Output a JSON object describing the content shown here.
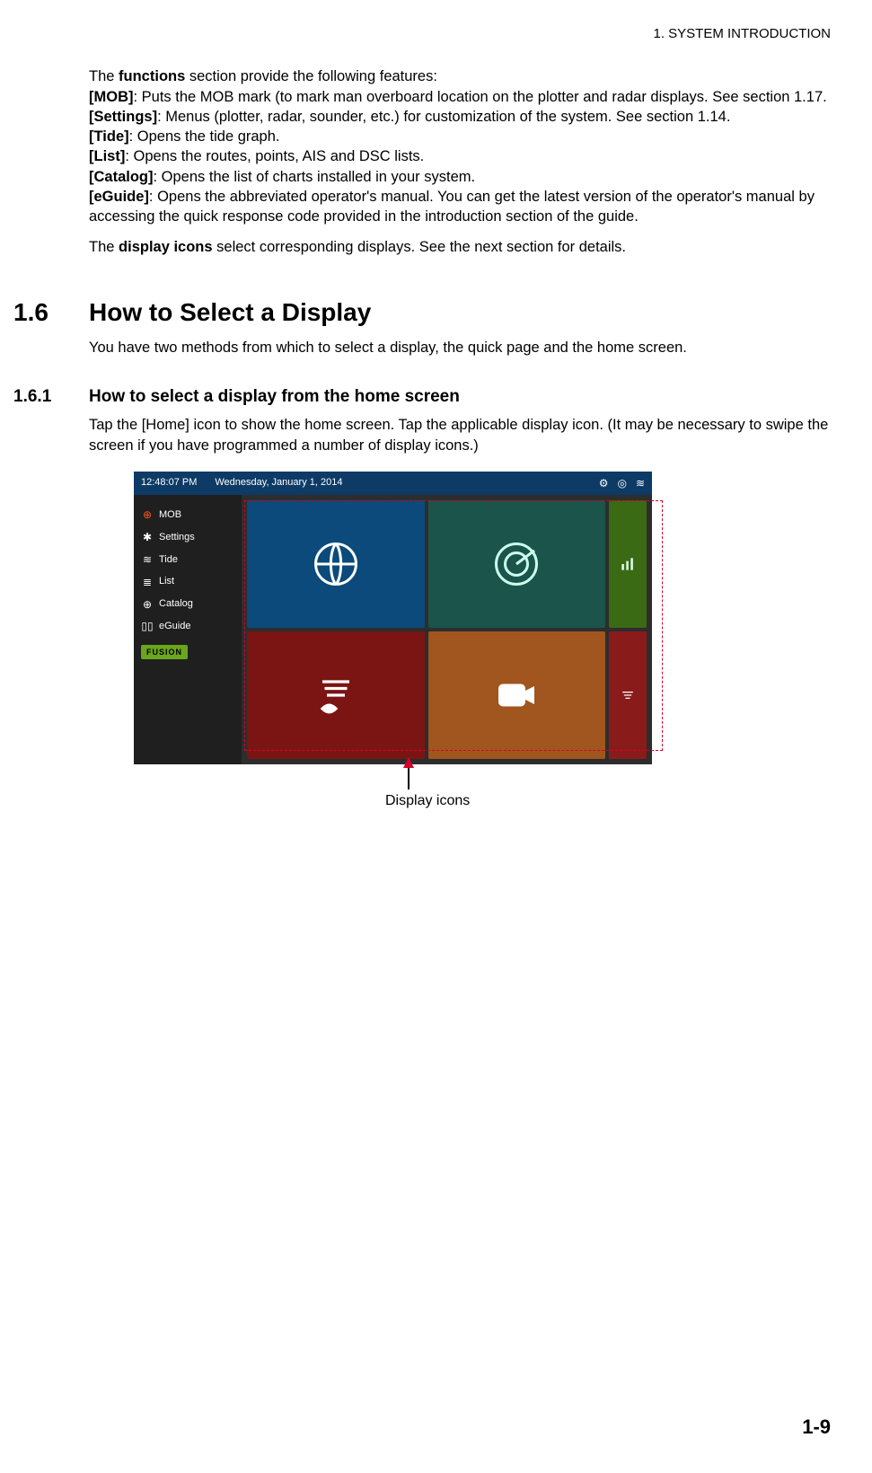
{
  "header": {
    "chapter": "1.  SYSTEM INTRODUCTION"
  },
  "intro": {
    "lead_pre": "The ",
    "lead_bold": "functions",
    "lead_post": " section provide the following features:",
    "items": [
      {
        "tag": "[MOB]",
        "desc": ": Puts the MOB mark (to mark man overboard location on the plotter and radar displays. See section 1.17."
      },
      {
        "tag": "[Settings]",
        "desc": ": Menus (plotter, radar, sounder, etc.) for customization of the system. See section 1.14."
      },
      {
        "tag": "[Tide]",
        "desc": ": Opens the tide graph."
      },
      {
        "tag": "[List]",
        "desc": ": Opens the routes, points, AIS and DSC lists."
      },
      {
        "tag": "[Catalog]",
        "desc": ": Opens the list of charts installed in your system."
      },
      {
        "tag": "[eGuide]",
        "desc": ": Opens the abbreviated operator's manual. You can get the latest version of the operator's manual by accessing the quick response code provided in the introduction section of the guide."
      }
    ],
    "trail_pre": "The ",
    "trail_bold": "display icons",
    "trail_post": " select corresponding displays. See the next section for details."
  },
  "sec16": {
    "num": "1.6",
    "title": "How to Select a Display",
    "body": "You have two methods from which to select a display, the quick page and the home screen."
  },
  "sec161": {
    "num": "1.6.1",
    "title": "How to select a display from the home screen",
    "body": "Tap the [Home] icon to show the home screen. Tap the applicable display icon. (It may be necessary to swipe the screen if you have programmed a number of display icons.)"
  },
  "screenshot": {
    "time": "12:48:07 PM",
    "date": "Wednesday, January 1, 2014",
    "sidebar": {
      "mob": "MOB",
      "settings": "Settings",
      "tide": "Tide",
      "list": "List",
      "catalog": "Catalog",
      "eguide": "eGuide",
      "fusion": "FUSION"
    }
  },
  "caption": "Display icons",
  "pagenum": "1-9"
}
